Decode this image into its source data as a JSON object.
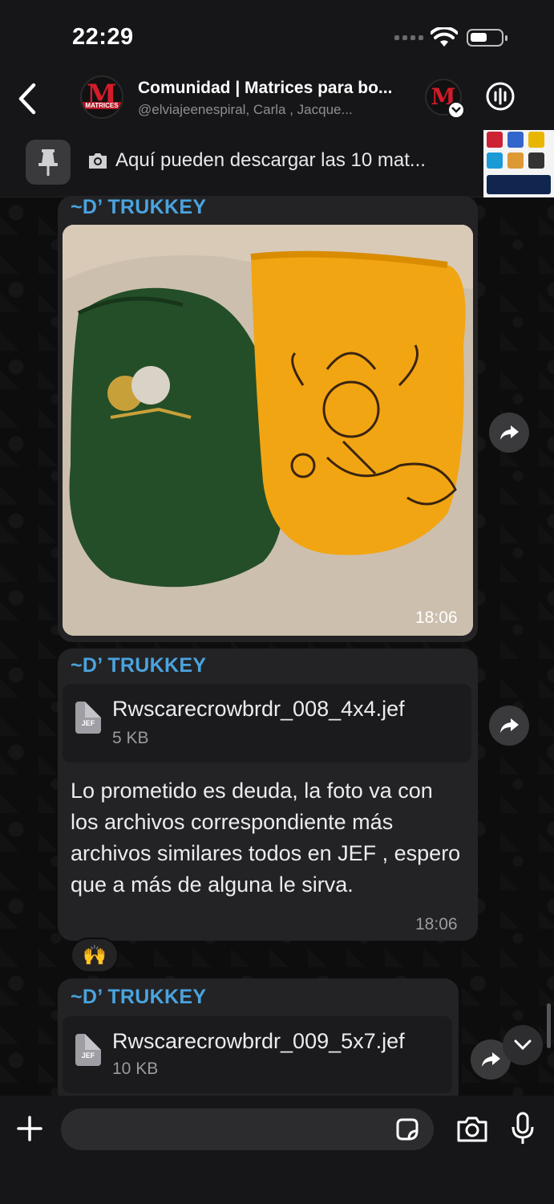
{
  "status_bar": {
    "time": "22:29"
  },
  "header": {
    "title": "Comunidad | Matrices para bo...",
    "subtitle": "@elviajeenespiral, Carla  , Jacque...",
    "avatar_text": "M",
    "avatar_caption": "MATRICES"
  },
  "pinned": {
    "text": "Aquí pueden descargar las 10 mat..."
  },
  "messages": [
    {
      "sender": "~D’ TRUKKEY",
      "time": "18:06"
    },
    {
      "sender": "~D’ TRUKKEY",
      "file": {
        "name": "Rwscarecrowbrdr_008_4x4.jef",
        "size": "5 KB",
        "ext": "JEF"
      },
      "text": "Lo prometido es deuda, la foto va con los archivos correspondiente más archivos similares  todos en JEF , espero que a más de alguna le sirva.",
      "time": "18:06",
      "reaction": "🙌"
    },
    {
      "sender": "~D’ TRUKKEY",
      "file": {
        "name": "Rwscarecrowbrdr_009_5x7.jef",
        "size": "10 KB",
        "ext": "JEF"
      }
    }
  ],
  "colors": {
    "accent": "#4aa3de",
    "bubble": "#232325",
    "brand_red": "#d51b2a"
  }
}
